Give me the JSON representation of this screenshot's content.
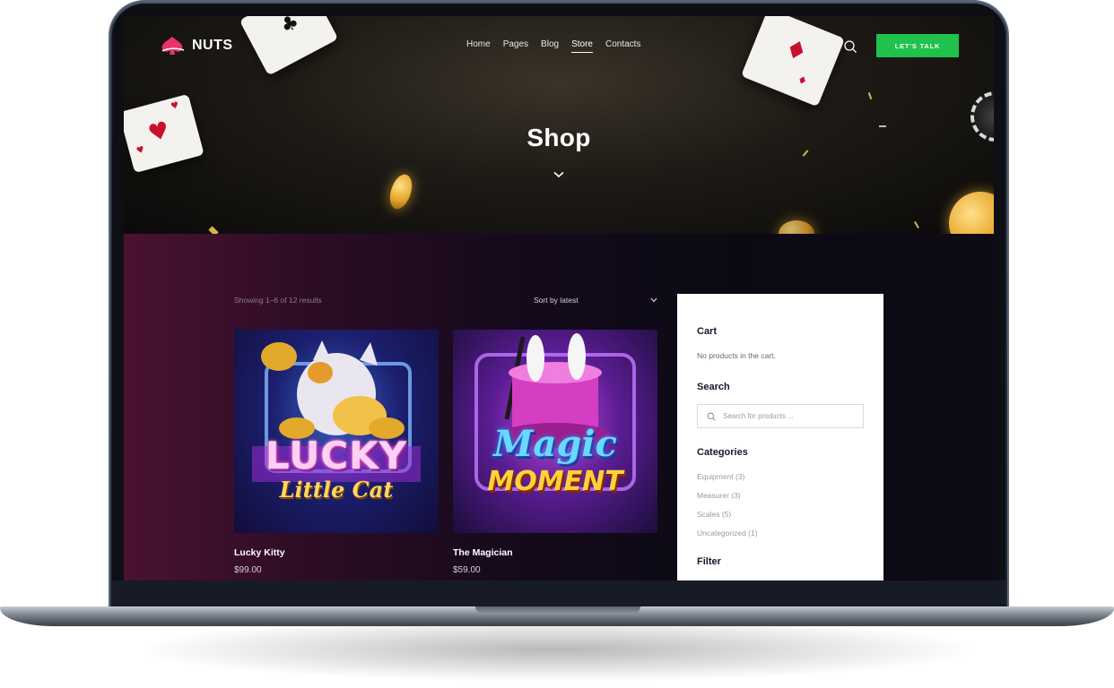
{
  "site": {
    "logo_text": "NUTS",
    "nav": [
      "Home",
      "Pages",
      "Blog",
      "Store",
      "Contacts"
    ],
    "active_nav": "Store",
    "cta_label": "LET'S TALK"
  },
  "hero": {
    "title": "Shop"
  },
  "shop": {
    "results_text": "Showing 1–6 of 12 results",
    "sort_label": "Sort by latest",
    "products": [
      {
        "name": "Lucky Kitty",
        "price": "$99.00",
        "art_line1": "LUCKY",
        "art_line2": "Little Cat"
      },
      {
        "name": "The Magician",
        "price": "$59.00",
        "art_line1": "Magic",
        "art_line2": "MOMENT"
      }
    ]
  },
  "sidebar": {
    "cart_title": "Cart",
    "cart_empty": "No products in the cart.",
    "search_title": "Search",
    "search_placeholder": "Search for products ...",
    "categories_title": "Categories",
    "categories": [
      "Equipment (3)",
      "Measurer (3)",
      "Scales (5)",
      "Uncategorized (1)"
    ],
    "filter_title": "Filter"
  },
  "colors": {
    "cta": "#1fc24a",
    "logo_accent": "#e8336e",
    "content_bg_left": "#4a1230",
    "content_bg_right": "#0b0a14"
  }
}
